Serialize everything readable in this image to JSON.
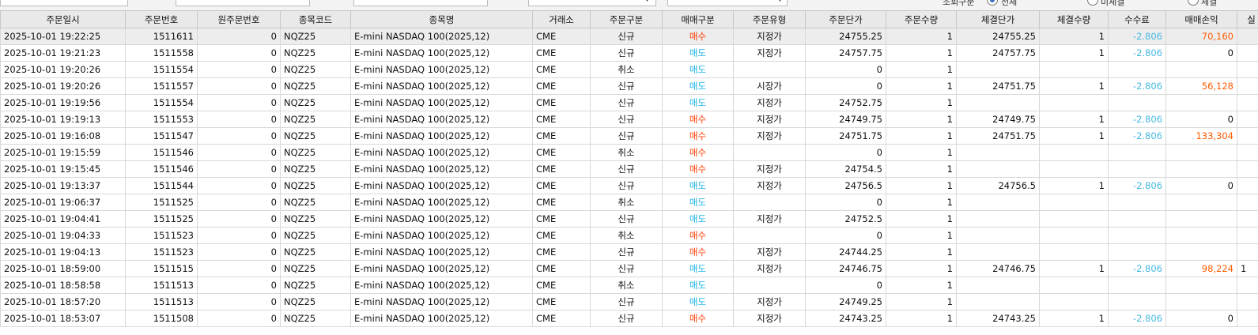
{
  "colors": {
    "buy": "#ff3c00",
    "sell": "#1ab3e6",
    "fee": "#46b8e0",
    "pnl_positive": "#ff5a00",
    "header_bg": "#e9e9e9"
  },
  "toolbar": {
    "radio_labels": [
      "조회구분",
      "전체",
      "미체결",
      "체결"
    ]
  },
  "columns": [
    "주문일시",
    "주문번호",
    "원주문번호",
    "종목코드",
    "종목명",
    "거래소",
    "주문구분",
    "매매구분",
    "주문유형",
    "주문단가",
    "주문수량",
    "체결단가",
    "체결수량",
    "수수료",
    "매매손익",
    "실"
  ],
  "rows": [
    {
      "time": "2025-10-01 19:22:25",
      "no": "1511611",
      "orig": "0",
      "code": "NQZ25",
      "name": "E-mini NASDAQ 100(2025,12)",
      "ex": "CME",
      "kind": "신규",
      "side": "매수",
      "type": "지정가",
      "price": "24755.25",
      "qty": "1",
      "fprice": "24755.25",
      "fqty": "1",
      "fee": "-2.806",
      "pnl": "70,160",
      "extra": ""
    },
    {
      "time": "2025-10-01 19:21:23",
      "no": "1511558",
      "orig": "0",
      "code": "NQZ25",
      "name": "E-mini NASDAQ 100(2025,12)",
      "ex": "CME",
      "kind": "신규",
      "side": "매도",
      "type": "지정가",
      "price": "24757.75",
      "qty": "1",
      "fprice": "24757.75",
      "fqty": "1",
      "fee": "-2.806",
      "pnl": "0",
      "extra": ""
    },
    {
      "time": "2025-10-01 19:20:26",
      "no": "1511554",
      "orig": "0",
      "code": "NQZ25",
      "name": "E-mini NASDAQ 100(2025,12)",
      "ex": "CME",
      "kind": "취소",
      "side": "매도",
      "type": "",
      "price": "0",
      "qty": "1",
      "fprice": "",
      "fqty": "",
      "fee": "",
      "pnl": "",
      "extra": ""
    },
    {
      "time": "2025-10-01 19:20:26",
      "no": "1511557",
      "orig": "0",
      "code": "NQZ25",
      "name": "E-mini NASDAQ 100(2025,12)",
      "ex": "CME",
      "kind": "신규",
      "side": "매도",
      "type": "시장가",
      "price": "0",
      "qty": "1",
      "fprice": "24751.75",
      "fqty": "1",
      "fee": "-2.806",
      "pnl": "56,128",
      "extra": ""
    },
    {
      "time": "2025-10-01 19:19:56",
      "no": "1511554",
      "orig": "0",
      "code": "NQZ25",
      "name": "E-mini NASDAQ 100(2025,12)",
      "ex": "CME",
      "kind": "신규",
      "side": "매도",
      "type": "지정가",
      "price": "24752.75",
      "qty": "1",
      "fprice": "",
      "fqty": "",
      "fee": "",
      "pnl": "",
      "extra": ""
    },
    {
      "time": "2025-10-01 19:19:13",
      "no": "1511553",
      "orig": "0",
      "code": "NQZ25",
      "name": "E-mini NASDAQ 100(2025,12)",
      "ex": "CME",
      "kind": "신규",
      "side": "매수",
      "type": "지정가",
      "price": "24749.75",
      "qty": "1",
      "fprice": "24749.75",
      "fqty": "1",
      "fee": "-2.806",
      "pnl": "0",
      "extra": ""
    },
    {
      "time": "2025-10-01 19:16:08",
      "no": "1511547",
      "orig": "0",
      "code": "NQZ25",
      "name": "E-mini NASDAQ 100(2025,12)",
      "ex": "CME",
      "kind": "신규",
      "side": "매수",
      "type": "지정가",
      "price": "24751.75",
      "qty": "1",
      "fprice": "24751.75",
      "fqty": "1",
      "fee": "-2.806",
      "pnl": "133,304",
      "extra": ""
    },
    {
      "time": "2025-10-01 19:15:59",
      "no": "1511546",
      "orig": "0",
      "code": "NQZ25",
      "name": "E-mini NASDAQ 100(2025,12)",
      "ex": "CME",
      "kind": "취소",
      "side": "매수",
      "type": "",
      "price": "0",
      "qty": "1",
      "fprice": "",
      "fqty": "",
      "fee": "",
      "pnl": "",
      "extra": ""
    },
    {
      "time": "2025-10-01 19:15:45",
      "no": "1511546",
      "orig": "0",
      "code": "NQZ25",
      "name": "E-mini NASDAQ 100(2025,12)",
      "ex": "CME",
      "kind": "신규",
      "side": "매수",
      "type": "지정가",
      "price": "24754.5",
      "qty": "1",
      "fprice": "",
      "fqty": "",
      "fee": "",
      "pnl": "",
      "extra": ""
    },
    {
      "time": "2025-10-01 19:13:37",
      "no": "1511544",
      "orig": "0",
      "code": "NQZ25",
      "name": "E-mini NASDAQ 100(2025,12)",
      "ex": "CME",
      "kind": "신규",
      "side": "매도",
      "type": "지정가",
      "price": "24756.5",
      "qty": "1",
      "fprice": "24756.5",
      "fqty": "1",
      "fee": "-2.806",
      "pnl": "0",
      "extra": ""
    },
    {
      "time": "2025-10-01 19:06:37",
      "no": "1511525",
      "orig": "0",
      "code": "NQZ25",
      "name": "E-mini NASDAQ 100(2025,12)",
      "ex": "CME",
      "kind": "취소",
      "side": "매도",
      "type": "",
      "price": "0",
      "qty": "1",
      "fprice": "",
      "fqty": "",
      "fee": "",
      "pnl": "",
      "extra": ""
    },
    {
      "time": "2025-10-01 19:04:41",
      "no": "1511525",
      "orig": "0",
      "code": "NQZ25",
      "name": "E-mini NASDAQ 100(2025,12)",
      "ex": "CME",
      "kind": "신규",
      "side": "매도",
      "type": "지정가",
      "price": "24752.5",
      "qty": "1",
      "fprice": "",
      "fqty": "",
      "fee": "",
      "pnl": "",
      "extra": ""
    },
    {
      "time": "2025-10-01 19:04:33",
      "no": "1511523",
      "orig": "0",
      "code": "NQZ25",
      "name": "E-mini NASDAQ 100(2025,12)",
      "ex": "CME",
      "kind": "취소",
      "side": "매수",
      "type": "",
      "price": "0",
      "qty": "1",
      "fprice": "",
      "fqty": "",
      "fee": "",
      "pnl": "",
      "extra": ""
    },
    {
      "time": "2025-10-01 19:04:13",
      "no": "1511523",
      "orig": "0",
      "code": "NQZ25",
      "name": "E-mini NASDAQ 100(2025,12)",
      "ex": "CME",
      "kind": "신규",
      "side": "매수",
      "type": "지정가",
      "price": "24744.25",
      "qty": "1",
      "fprice": "",
      "fqty": "",
      "fee": "",
      "pnl": "",
      "extra": ""
    },
    {
      "time": "2025-10-01 18:59:00",
      "no": "1511515",
      "orig": "0",
      "code": "NQZ25",
      "name": "E-mini NASDAQ 100(2025,12)",
      "ex": "CME",
      "kind": "신규",
      "side": "매도",
      "type": "지정가",
      "price": "24746.75",
      "qty": "1",
      "fprice": "24746.75",
      "fqty": "1",
      "fee": "-2.806",
      "pnl": "98,224",
      "extra": "1"
    },
    {
      "time": "2025-10-01 18:58:58",
      "no": "1511513",
      "orig": "0",
      "code": "NQZ25",
      "name": "E-mini NASDAQ 100(2025,12)",
      "ex": "CME",
      "kind": "취소",
      "side": "매도",
      "type": "",
      "price": "0",
      "qty": "1",
      "fprice": "",
      "fqty": "",
      "fee": "",
      "pnl": "",
      "extra": ""
    },
    {
      "time": "2025-10-01 18:57:20",
      "no": "1511513",
      "orig": "0",
      "code": "NQZ25",
      "name": "E-mini NASDAQ 100(2025,12)",
      "ex": "CME",
      "kind": "신규",
      "side": "매도",
      "type": "지정가",
      "price": "24749.25",
      "qty": "1",
      "fprice": "",
      "fqty": "",
      "fee": "",
      "pnl": "",
      "extra": ""
    },
    {
      "time": "2025-10-01 18:53:07",
      "no": "1511508",
      "orig": "0",
      "code": "NQZ25",
      "name": "E-mini NASDAQ 100(2025,12)",
      "ex": "CME",
      "kind": "신규",
      "side": "매수",
      "type": "지정가",
      "price": "24743.25",
      "qty": "1",
      "fprice": "24743.25",
      "fqty": "1",
      "fee": "-2.806",
      "pnl": "0",
      "extra": ""
    }
  ]
}
